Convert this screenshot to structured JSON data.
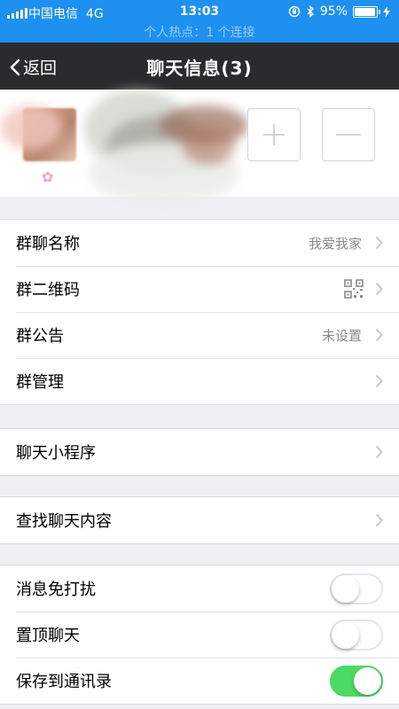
{
  "status_bar": {
    "carrier": "中国电信",
    "network": "4G",
    "time": "13:03",
    "battery": "95%",
    "battery_level": 0.95,
    "hotspot": "个人热点：1 个连接"
  },
  "nav": {
    "back_label": "返回",
    "title": "聊天信息(3)"
  },
  "sections": {
    "group_info": [
      {
        "label": "群聊名称",
        "value": "我爱我家"
      },
      {
        "label": "群二维码",
        "value": ""
      },
      {
        "label": "群公告",
        "value": "未设置"
      },
      {
        "label": "群管理",
        "value": ""
      }
    ],
    "mini_program": {
      "label": "聊天小程序"
    },
    "search": {
      "label": "查找聊天内容"
    },
    "settings": [
      {
        "label": "消息免打扰",
        "on": false
      },
      {
        "label": "置顶聊天",
        "on": false
      },
      {
        "label": "保存到通讯录",
        "on": true
      }
    ]
  },
  "colors": {
    "status_bar": "#1E90F0",
    "nav_bar": "#2B2B2D",
    "switch_on": "#4CD964"
  }
}
